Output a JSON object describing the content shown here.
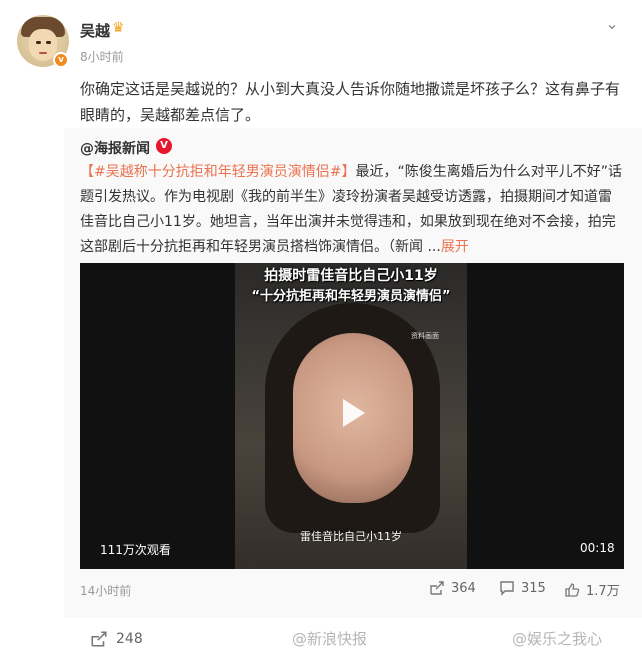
{
  "post": {
    "username": "吴越",
    "timestamp": "8小时前",
    "text": "你确定这话是吴越说的？从小到大真没人告诉你随地撒谎是坏孩子么？这有鼻子有眼睛的，吴越都差点信了。",
    "more_label": "⌄"
  },
  "repost": {
    "source": "@海报新闻",
    "hashtag": "【#吴越称十分抗拒和年轻男演员演情侣#】",
    "body": "最近，“陈俊生离婚后为什么对平儿不好”话题引发热议。作为电视剧《我的前半生》凌玲扮演者吴越受访透露，拍摄期间才知道雷佳音比自己小11岁。她坦言，当年出演并未觉得违和，如果放到现在绝对不会接，拍完这部剧后十分抗拒再和年轻男演员搭档饰演情侣。（新闻 ...",
    "expand_label": "展开",
    "video": {
      "caption_top": "拍摄时雷佳音比自己小11岁",
      "caption_quote": "“十分抗拒再和年轻男演员演情侣”",
      "tag": "资料画面",
      "subtitle": "雷佳音比自己小11岁",
      "views": "111万次观看",
      "duration": "00:18"
    },
    "time": "14小时前",
    "reposts": "364",
    "comments": "315",
    "likes": "1.7万"
  },
  "footer": {
    "reposts": "248",
    "watermark_1": "@新浪快报",
    "watermark_2": "@娱乐之我心"
  },
  "colors": {
    "accent": "#eb7350",
    "vip_badge": "#f28a1d",
    "gov_badge": "#e6162d"
  }
}
